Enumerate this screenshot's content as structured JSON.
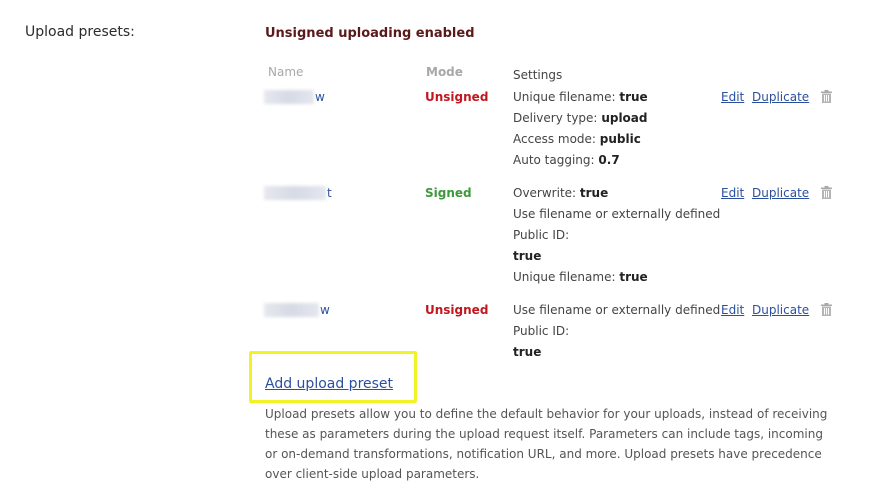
{
  "section": {
    "label": "Upload presets:",
    "status": "Unsigned uploading enabled"
  },
  "columns": {
    "name": "Name",
    "mode": "Mode",
    "settings": "Settings"
  },
  "presets": [
    {
      "name_suffix": "w",
      "mode": "Unsigned",
      "settings": [
        {
          "key": "Unique filename:",
          "value": "true"
        },
        {
          "key": "Delivery type:",
          "value": "upload"
        },
        {
          "key": "Access mode:",
          "value": "public"
        },
        {
          "key": "Auto tagging:",
          "value": "0.7"
        }
      ]
    },
    {
      "name_suffix": "t",
      "mode": "Signed",
      "settings": [
        {
          "key": "Overwrite:",
          "value": "true"
        },
        {
          "key": "Use filename or externally defined",
          "value": ""
        },
        {
          "key": "Public ID:",
          "value": ""
        },
        {
          "key": "",
          "value": "true"
        },
        {
          "key": "Unique filename:",
          "value": "true"
        }
      ]
    },
    {
      "name_suffix": "w",
      "mode": "Unsigned",
      "settings": [
        {
          "key": "Use filename or externally defined",
          "value": ""
        },
        {
          "key": "Public ID:",
          "value": ""
        },
        {
          "key": "",
          "value": "true"
        }
      ]
    }
  ],
  "actions": {
    "edit": "Edit",
    "duplicate": "Duplicate",
    "delete_icon": "trash-icon"
  },
  "add_preset": "Add upload preset",
  "help_text": "Upload presets allow you to define the default behavior for your uploads, instead of receiving these as parameters during the upload request itself. Parameters can include tags, incoming or on-demand transformations, notification URL, and more. Upload presets have precedence over client-side upload parameters.",
  "colors": {
    "unsigned": "#c0181e",
    "signed": "#3c9a3c",
    "link": "#2a4fa0",
    "highlight": "#f3f227"
  }
}
